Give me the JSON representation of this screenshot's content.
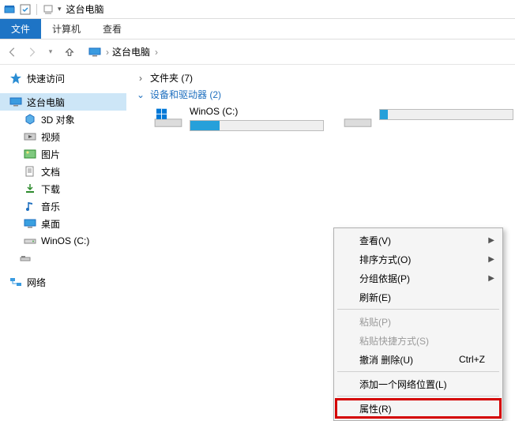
{
  "titlebar": {
    "title": "这台电脑"
  },
  "ribbon": {
    "file": "文件",
    "tabs": [
      "计算机",
      "查看"
    ]
  },
  "address": {
    "crumb": "这台电脑",
    "sep": "›"
  },
  "sidebar": {
    "quick_access": "快速访问",
    "this_pc": "这台电脑",
    "children": [
      {
        "label": "3D 对象"
      },
      {
        "label": "视频"
      },
      {
        "label": "图片"
      },
      {
        "label": "文档"
      },
      {
        "label": "下载"
      },
      {
        "label": "音乐"
      },
      {
        "label": "桌面"
      },
      {
        "label": "WinOS (C:)"
      }
    ],
    "network": "网络"
  },
  "main": {
    "folders_header": "文件夹 (7)",
    "devices_header": "设备和驱动器 (2)",
    "drives": [
      {
        "name": "WinOS (C:)",
        "fill_pct": 22
      },
      {
        "name": "",
        "fill_pct": 6
      }
    ]
  },
  "context_menu": {
    "items": [
      {
        "label": "查看(V)",
        "submenu": true
      },
      {
        "label": "排序方式(O)",
        "submenu": true
      },
      {
        "label": "分组依据(P)",
        "submenu": true
      },
      {
        "label": "刷新(E)"
      },
      {
        "sep": true
      },
      {
        "label": "粘贴(P)",
        "disabled": true
      },
      {
        "label": "粘贴快捷方式(S)",
        "disabled": true
      },
      {
        "label": "撤消 删除(U)",
        "shortcut": "Ctrl+Z"
      },
      {
        "sep": true
      },
      {
        "label": "添加一个网络位置(L)"
      },
      {
        "sep": true
      },
      {
        "label": "属性(R)",
        "highlight": true
      }
    ]
  }
}
